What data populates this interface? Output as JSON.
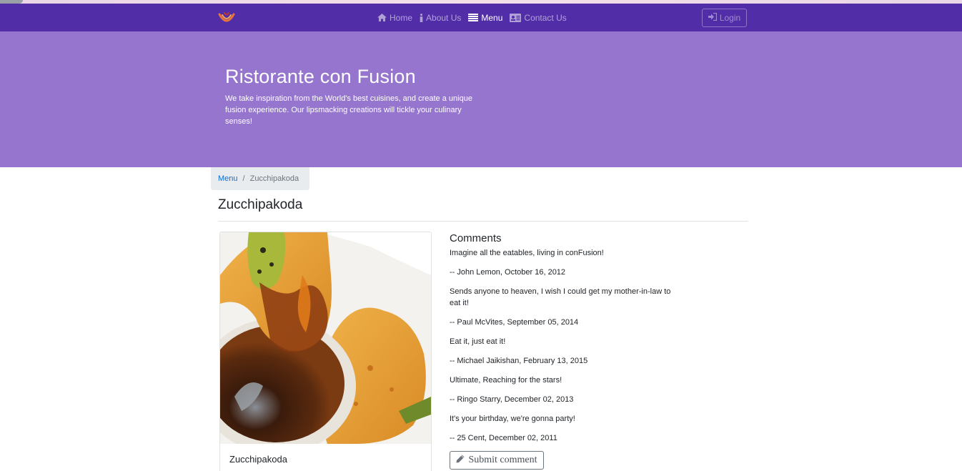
{
  "navbar": {
    "brand_icon": "restaurant-logo-icon",
    "items": [
      {
        "label": "Home",
        "icon": "home-icon",
        "active": false
      },
      {
        "label": "About Us",
        "icon": "info-icon",
        "active": false
      },
      {
        "label": "Menu",
        "icon": "list-icon",
        "active": true
      },
      {
        "label": "Contact Us",
        "icon": "address-card-icon",
        "active": false
      }
    ],
    "login_label": "Login",
    "login_icon": "sign-in-icon",
    "background_color": "#512da8"
  },
  "jumbotron": {
    "title": "Ristorante con Fusion",
    "text": "We take inspiration from the World's best cuisines, and create a unique fusion experience. Our lipsmacking creations will tickle your culinary senses!",
    "background_color": "#9575cd"
  },
  "breadcrumb": {
    "items": [
      {
        "label": "Menu",
        "link": true
      },
      {
        "label": "Zucchipakoda",
        "link": false
      }
    ]
  },
  "dish": {
    "name": "Zucchipakoda",
    "card_title": "Zucchipakoda",
    "image_icon": "zucchipakoda-photo"
  },
  "comments": {
    "heading": "Comments",
    "items": [
      {
        "text": "Imagine all the eatables, living in conFusion!",
        "author": "-- John Lemon,  October 16, 2012"
      },
      {
        "text": "Sends anyone to heaven, I wish I could get my mother-in-law to eat it!",
        "author": "-- Paul McVites,  September 05, 2014"
      },
      {
        "text": "Eat it, just eat it!",
        "author": "-- Michael Jaikishan,  February 13, 2015"
      },
      {
        "text": "Ultimate, Reaching for the stars!",
        "author": "-- Ringo Starry,  December 02, 2013"
      },
      {
        "text": "It's your birthday, we're gonna party!",
        "author": "-- 25 Cent,  December 02, 2011"
      }
    ],
    "submit_label": "Submit comment",
    "submit_icon": "pencil-icon"
  }
}
